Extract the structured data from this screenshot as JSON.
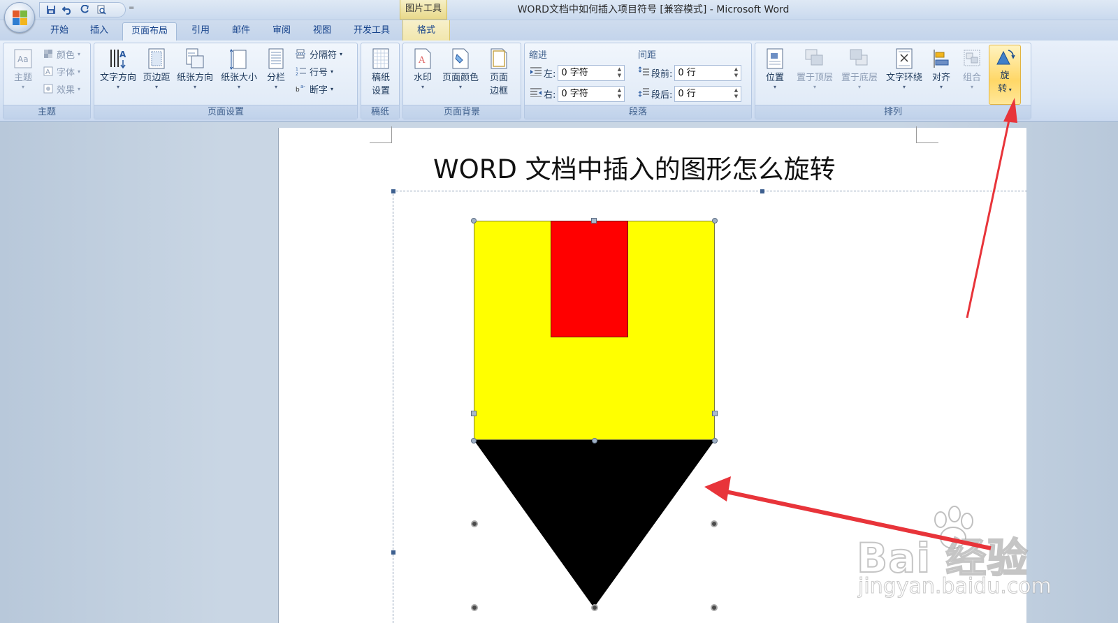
{
  "window": {
    "title": "WORD文档中如何插入项目符号 [兼容模式] - Microsoft Word",
    "context_tab_group": "图片工具"
  },
  "quick_access": {
    "icons": [
      "save-icon",
      "undo-icon",
      "redo-icon",
      "print-preview-icon"
    ],
    "more": "="
  },
  "tabs": [
    {
      "label": "开始",
      "active": false
    },
    {
      "label": "插入",
      "active": false
    },
    {
      "label": "页面布局",
      "active": true
    },
    {
      "label": "引用",
      "active": false
    },
    {
      "label": "邮件",
      "active": false
    },
    {
      "label": "审阅",
      "active": false
    },
    {
      "label": "视图",
      "active": false
    },
    {
      "label": "开发工具",
      "active": false
    },
    {
      "label": "格式",
      "active": false,
      "context": true
    }
  ],
  "ribbon": {
    "theme": {
      "label": "主题",
      "big": "主题",
      "colors": "颜色",
      "fonts": "字体",
      "effects": "效果"
    },
    "page_setup": {
      "label": "页面设置",
      "text_direction": "文字方向",
      "margins": "页边距",
      "orientation": "纸张方向",
      "size": "纸张大小",
      "columns": "分栏",
      "breaks": "分隔符",
      "line_numbers": "行号",
      "hyphenation": "断字"
    },
    "manuscript": {
      "label": "稿纸",
      "settings_line1": "稿纸",
      "settings_line2": "设置"
    },
    "page_background": {
      "label": "页面背景",
      "watermark": "水印",
      "page_color": "页面颜色",
      "borders_line1": "页面",
      "borders_line2": "边框"
    },
    "paragraph": {
      "label": "段落",
      "indent_title": "缩进",
      "spacing_title": "间距",
      "indent_left_label": "左:",
      "indent_left_value": "0 字符",
      "indent_right_label": "右:",
      "indent_right_value": "0 字符",
      "space_before_label": "段前:",
      "space_before_value": "0 行",
      "space_after_label": "段后:",
      "space_after_value": "0 行"
    },
    "arrange": {
      "label": "排列",
      "position": "位置",
      "bring_to_front": "置于顶层",
      "send_to_back": "置于底层",
      "text_wrapping": "文字环绕",
      "align": "对齐",
      "group": "组合",
      "rotate_line1": "旋",
      "rotate_line2": "转"
    }
  },
  "document": {
    "heading": "WORD 文档中插入的图形怎么旋转"
  },
  "colors": {
    "shape_yellow": "#ffff00",
    "shape_red": "#ff0000",
    "shape_black": "#000000",
    "annotation_arrow": "#e8343a"
  },
  "watermark": {
    "brand": "Bai  经验",
    "url": "jingyan.baidu.com"
  }
}
